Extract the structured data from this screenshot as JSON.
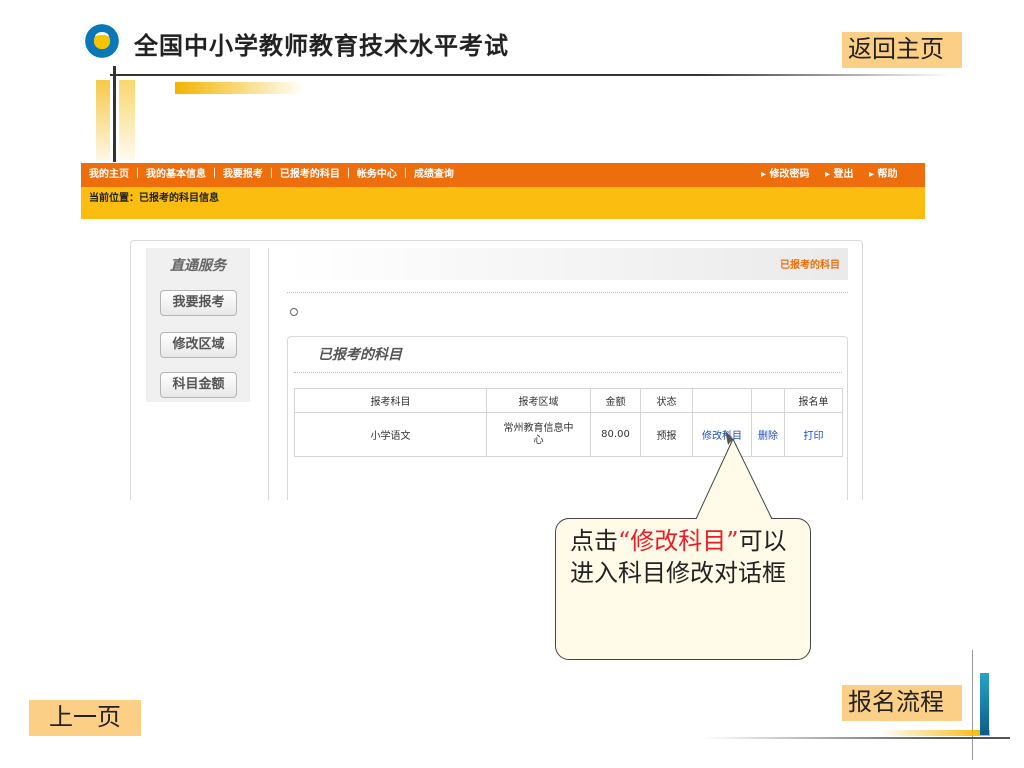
{
  "slide": {
    "title": "全国中小学教师教育技术水平考试",
    "home_button": "返回主页",
    "prev_button": "上一页",
    "flow_button": "报名流程"
  },
  "site": {
    "nav_links": [
      "我的主页",
      "我的基本信息",
      "我要报考",
      "已报考的科目",
      "帐务中心",
      "成绩查询"
    ],
    "nav_right": [
      "修改密码",
      "登出",
      "帮助"
    ],
    "breadcrumb": "当前位置：已报考的科目信息",
    "sidebar": {
      "title": "直通服务",
      "buttons": [
        "我要报考",
        "修改区域",
        "科目金额"
      ]
    },
    "header_tag": "已报考的科目",
    "table_title": "已报考的科目",
    "table": {
      "headers": [
        "报考科目",
        "报考区域",
        "金额",
        "状态",
        "",
        "",
        "报名单"
      ],
      "rows": [
        {
          "subject": "小学语文",
          "region": "常州教育信息中心",
          "amount": "80.00",
          "status": "预报",
          "edit": "修改科目",
          "delete": "删除",
          "print": "打印"
        }
      ]
    }
  },
  "callout": {
    "pre": "点击",
    "quote_open": "“",
    "highlight": "修改科目",
    "quote_close": "”",
    "post": "可以进入科目修改对话框"
  }
}
